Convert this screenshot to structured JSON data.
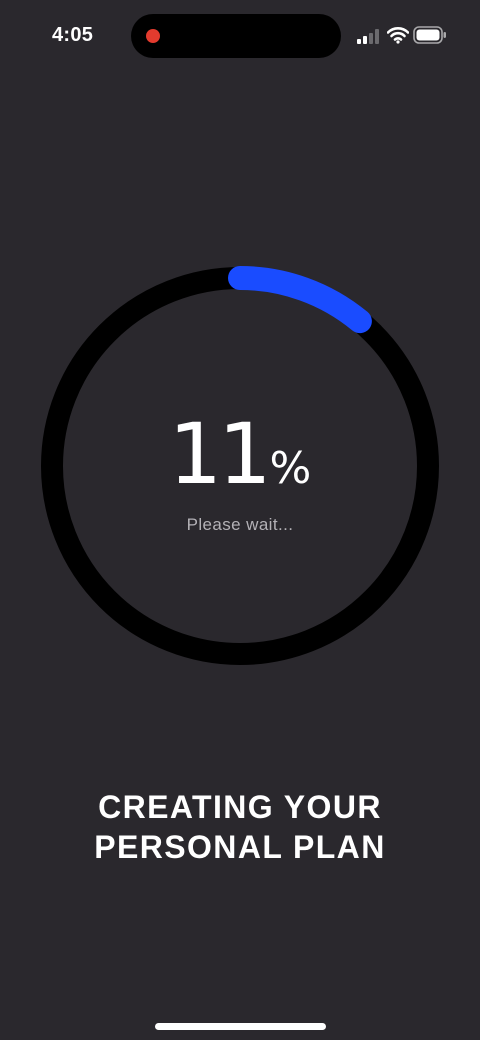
{
  "status_bar": {
    "time": "4:05",
    "recording_dot_color": "#e33b2e",
    "icons": [
      "signal-icon",
      "wifi-icon",
      "battery-icon"
    ]
  },
  "progress": {
    "percent": 11,
    "value_text": "11",
    "unit": "%",
    "subtitle": "Please wait...",
    "track_color": "#000000",
    "fill_color": "#1a4cff"
  },
  "title": {
    "line1": "CREATING YOUR",
    "line2": "PERSONAL PLAN"
  },
  "colors": {
    "background": "#2a282d",
    "text": "#ffffff",
    "muted_text": "#b3b1b6"
  }
}
